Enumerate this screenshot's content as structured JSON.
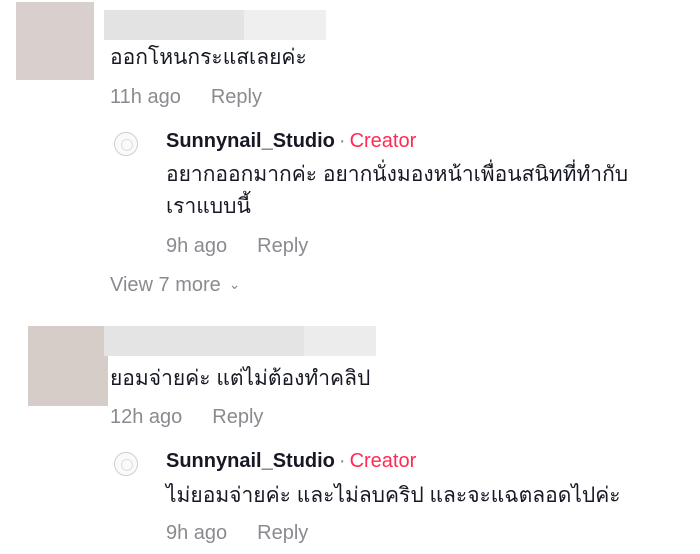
{
  "comments": [
    {
      "text": "ออกโหนกระแสเลยค่ะ",
      "time": "11h ago",
      "reply_label": "Reply",
      "reply": {
        "author": "Sunnynail_Studio",
        "separator": "·",
        "badge": "Creator",
        "text_line1": "อยากออกมากค่ะ อยากนั่งมองหน้าเพื่อนสนิทที่ทำกับ",
        "text_line2": "เราแบบนี้",
        "time": "9h ago",
        "reply_label": "Reply"
      },
      "view_more": "View 7 more"
    },
    {
      "text": "ยอมจ่ายค่ะ แต่ไม่ต้องทำคลิป",
      "time": "12h ago",
      "reply_label": "Reply",
      "reply": {
        "author": "Sunnynail_Studio",
        "separator": "·",
        "badge": "Creator",
        "text_line1": "ไม่ยอมจ่ายค่ะ และไม่ลบคริป และจะแฉตลอดไปค่ะ",
        "time": "9h ago",
        "reply_label": "Reply"
      }
    }
  ],
  "colors": {
    "creator_badge": "#fe2c55",
    "meta_text": "#8a8b91",
    "primary_text": "#161823"
  }
}
